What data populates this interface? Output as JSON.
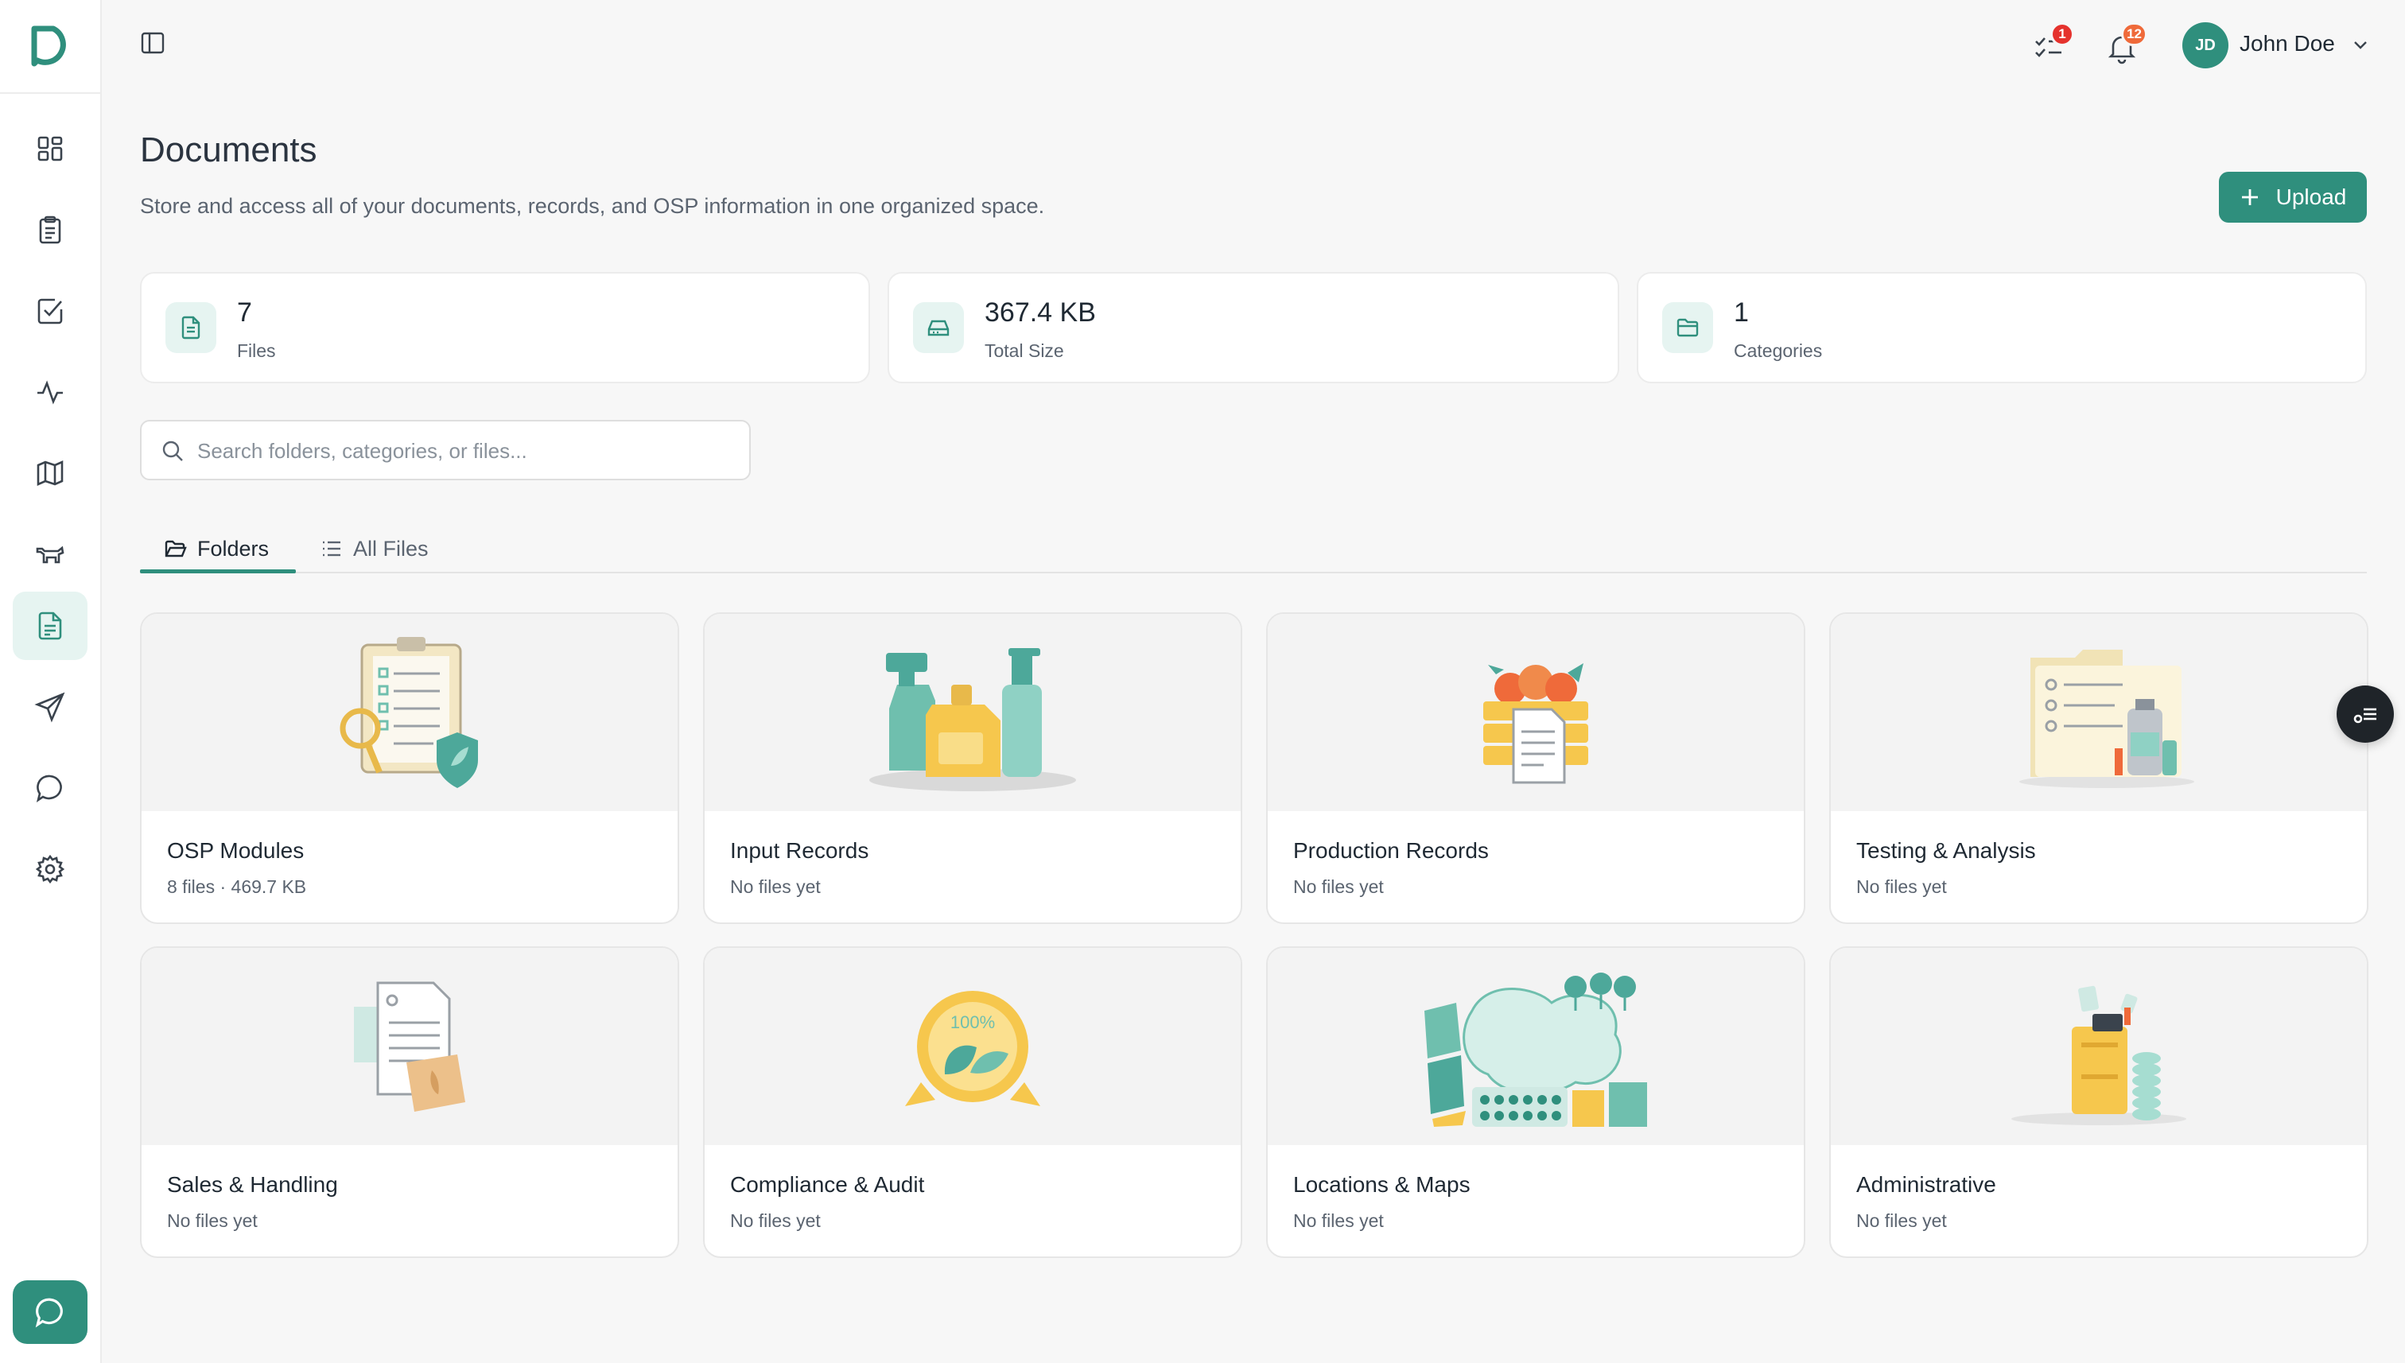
{
  "sidebar": {
    "items": [
      {
        "name": "dashboard",
        "active": false
      },
      {
        "name": "tasks",
        "active": false
      },
      {
        "name": "checklist",
        "active": false
      },
      {
        "name": "activity",
        "active": false
      },
      {
        "name": "map",
        "active": false
      },
      {
        "name": "livestock",
        "active": false
      },
      {
        "name": "documents",
        "active": true
      },
      {
        "name": "send",
        "active": false
      },
      {
        "name": "messages",
        "active": false
      },
      {
        "name": "settings",
        "active": false
      }
    ]
  },
  "topbar": {
    "tasks_badge": "1",
    "notifications_badge": "12",
    "user_initials": "JD",
    "user_name": "John Doe"
  },
  "header": {
    "title": "Documents",
    "subtitle": "Store and access all of your documents, records, and OSP information in one organized space.",
    "upload_label": "Upload"
  },
  "stats": [
    {
      "value": "7",
      "label": "Files",
      "icon": "file-icon"
    },
    {
      "value": "367.4 KB",
      "label": "Total Size",
      "icon": "storage-icon"
    },
    {
      "value": "1",
      "label": "Categories",
      "icon": "folder-icon"
    }
  ],
  "search": {
    "placeholder": "Search folders, categories, or files..."
  },
  "tabs": [
    {
      "label": "Folders",
      "active": true
    },
    {
      "label": "All Files",
      "active": false
    }
  ],
  "folders": [
    {
      "title": "OSP Modules",
      "meta": "8 files · 469.7 KB"
    },
    {
      "title": "Input Records",
      "meta": "No files yet"
    },
    {
      "title": "Production Records",
      "meta": "No files yet"
    },
    {
      "title": "Testing & Analysis",
      "meta": "No files yet"
    },
    {
      "title": "Sales & Handling",
      "meta": "No files yet"
    },
    {
      "title": "Compliance & Audit",
      "meta": "No files yet",
      "illustration_text": "100%"
    },
    {
      "title": "Locations & Maps",
      "meta": "No files yet"
    },
    {
      "title": "Administrative",
      "meta": "No files yet"
    }
  ],
  "colors": {
    "accent": "#2f8f7d",
    "accent_light": "#e6f4f1",
    "badge_red": "#e5322d",
    "badge_orange": "#ef6a3a",
    "text_dark": "#1f2933",
    "text_muted": "#5b6470"
  }
}
